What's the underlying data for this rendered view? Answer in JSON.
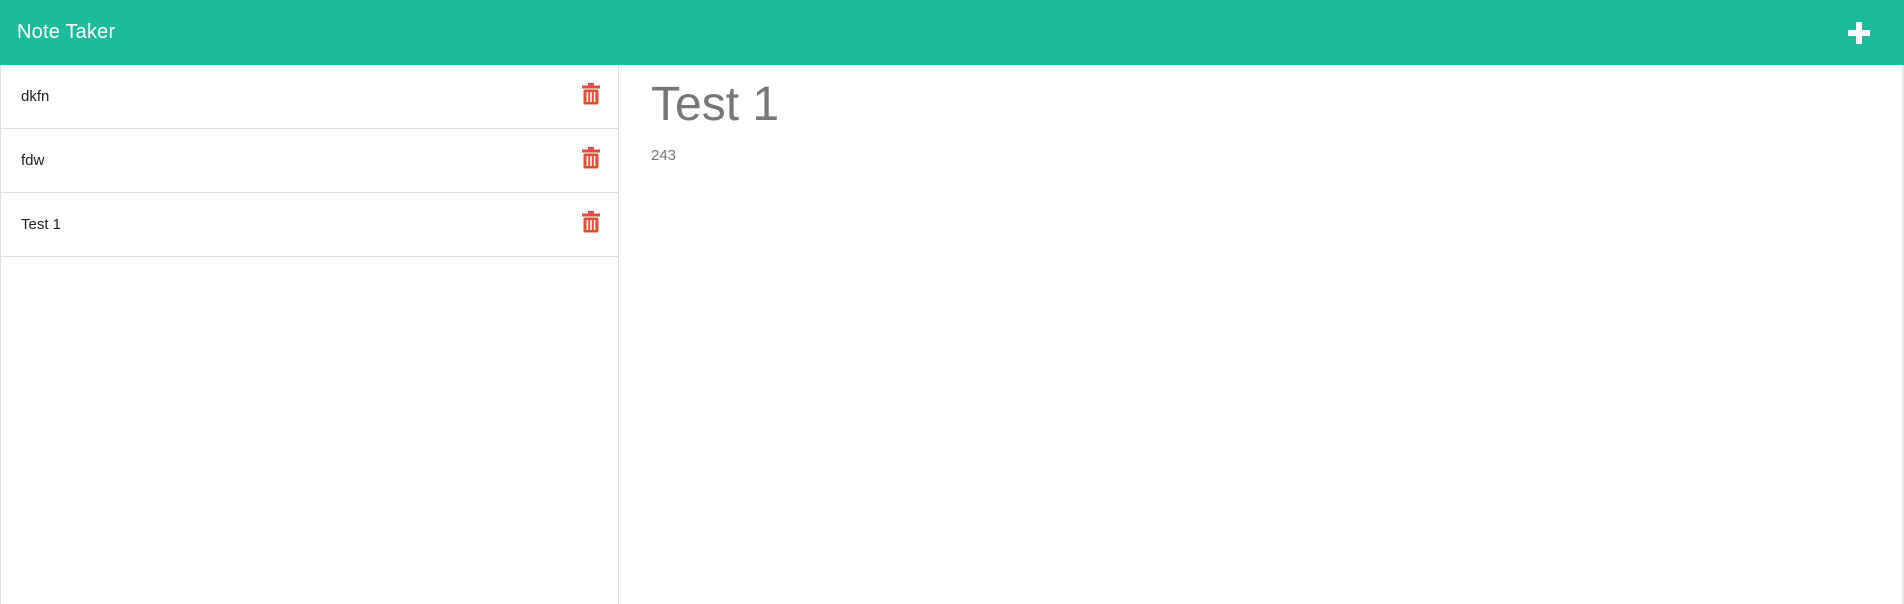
{
  "app": {
    "title": "Note Taker",
    "new_note_icon": "plus-icon"
  },
  "notes": [
    {
      "title": "dkfn",
      "delete_icon": "trash-icon"
    },
    {
      "title": "fdw",
      "delete_icon": "trash-icon"
    },
    {
      "title": "Test 1",
      "delete_icon": "trash-icon"
    }
  ],
  "active_note": {
    "title": "Test 1",
    "text": "243"
  },
  "colors": {
    "accent": "#1abc9c",
    "delete": "#e74c3c",
    "muted_text": "#777777"
  }
}
